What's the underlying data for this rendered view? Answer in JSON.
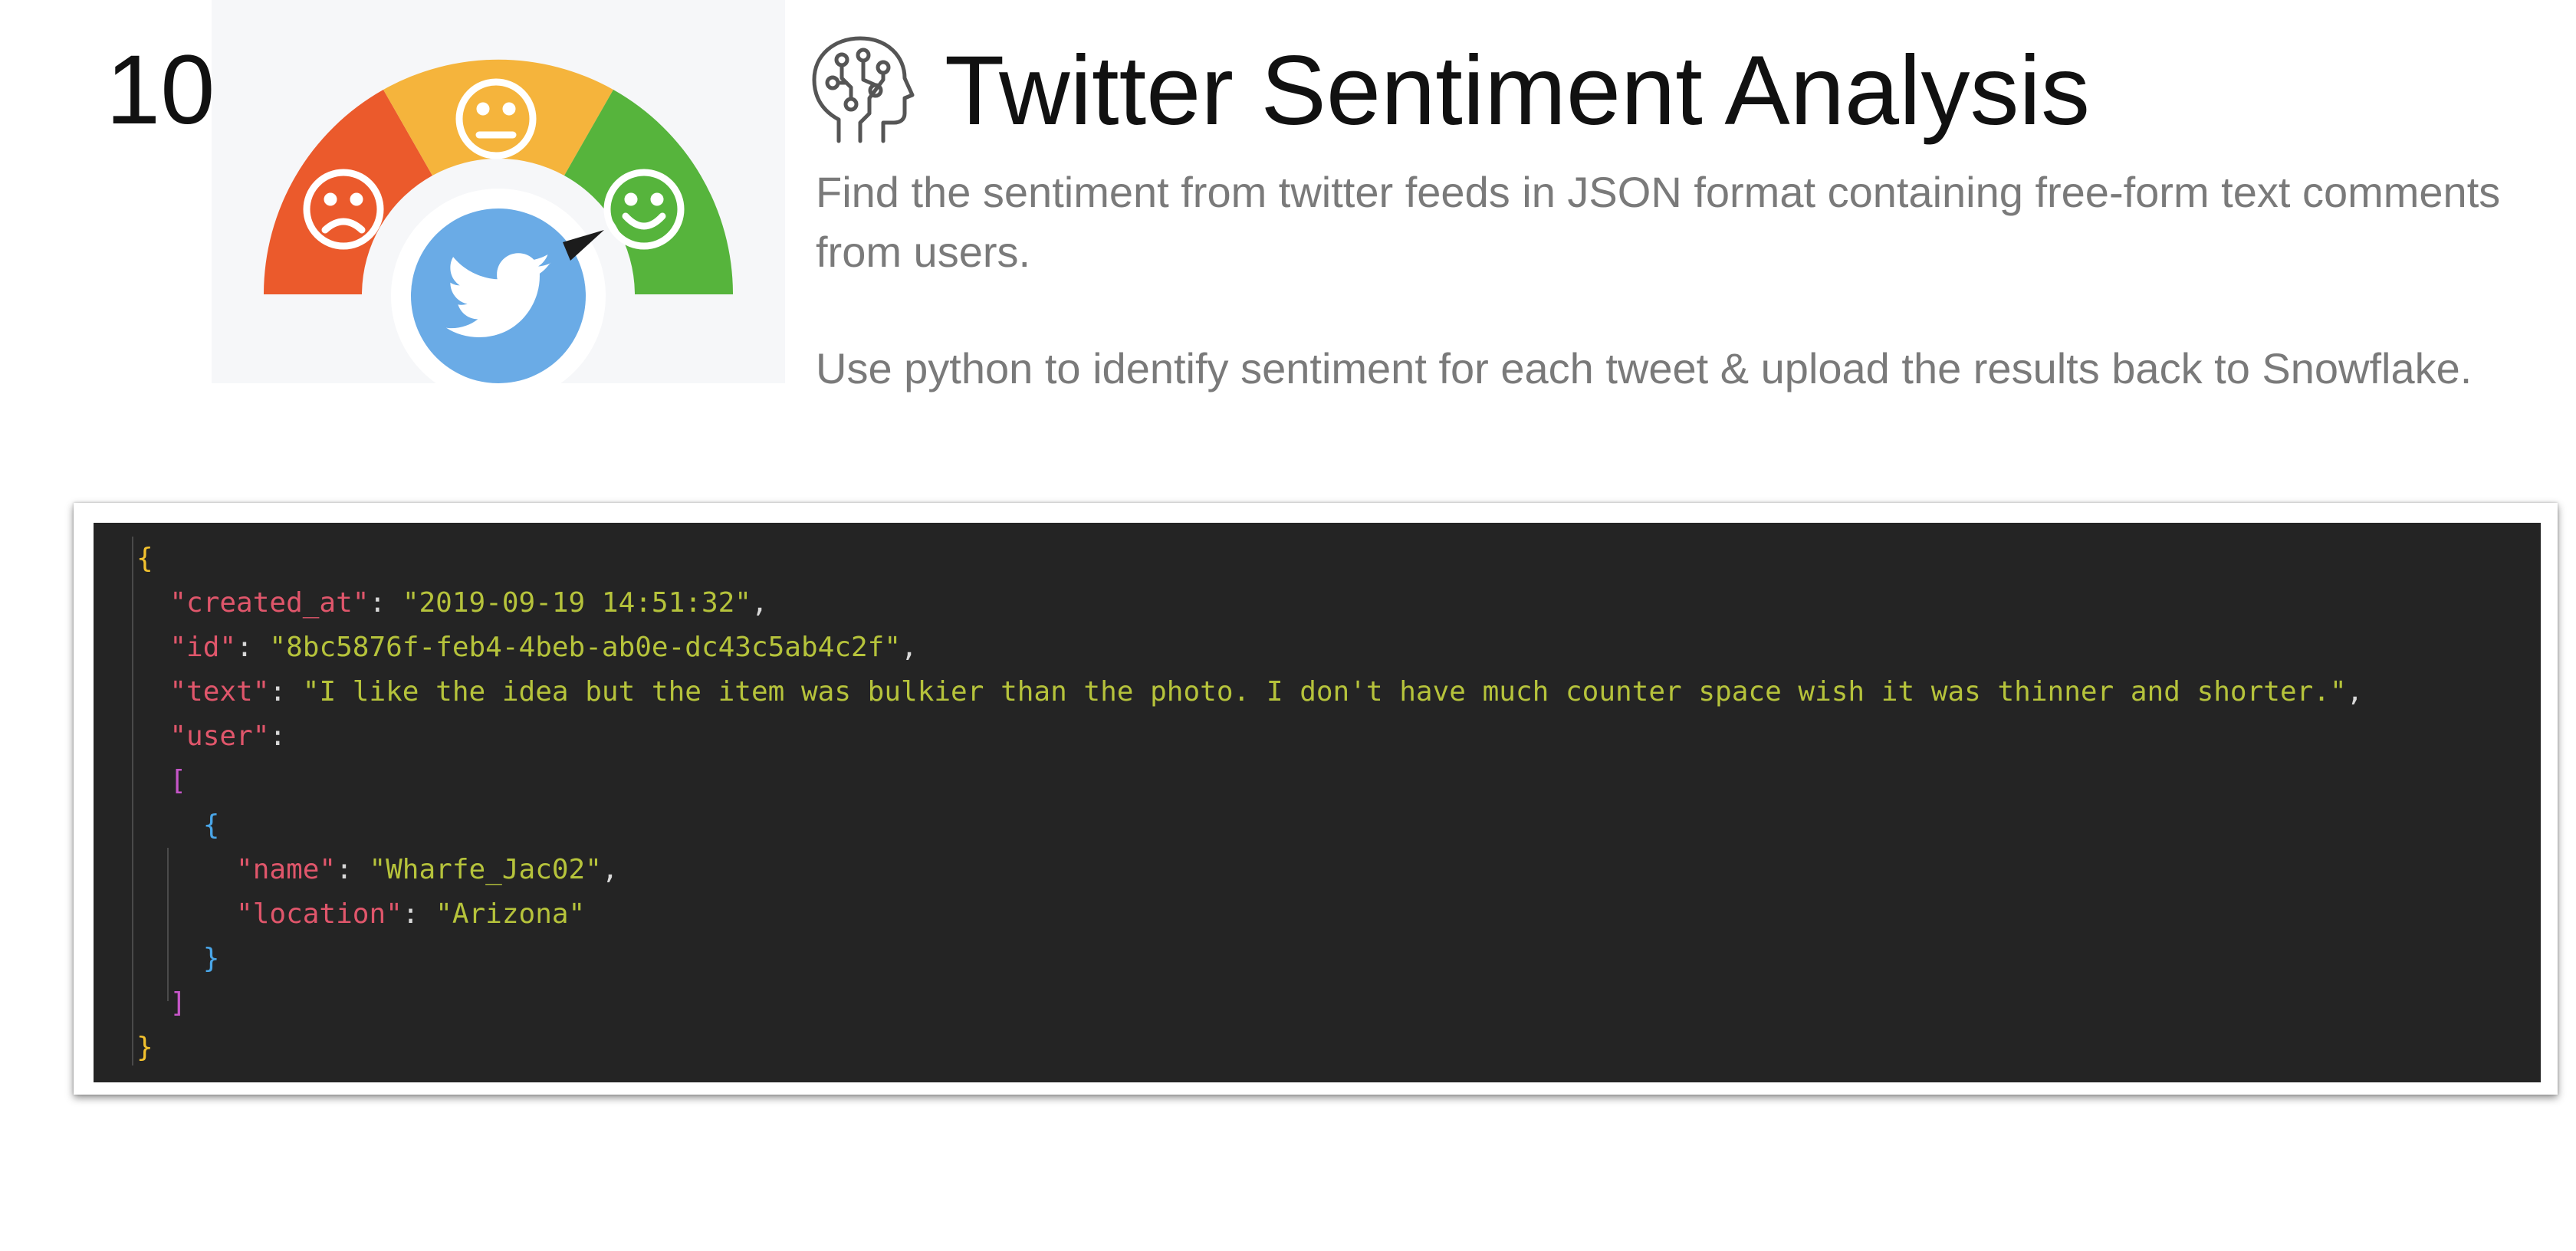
{
  "slide": {
    "number": "10.",
    "title": "Twitter Sentiment Analysis",
    "description_1": "Find the sentiment from twitter feeds in JSON format containing free-form text comments from users.",
    "description_2": "Use python to identify sentiment for each tweet & upload the results back to Snowflake."
  },
  "illustration": {
    "icons": [
      "sad-face-icon",
      "neutral-face-icon",
      "happy-face-icon",
      "twitter-bird-icon",
      "gauge-needle-icon",
      "brain-circuit-icon"
    ],
    "colors": {
      "negative": "#eb5a2c",
      "neutral": "#f5b43c",
      "positive": "#56b43c",
      "twitter": "#6aabe6"
    }
  },
  "code": {
    "open_brace": "{",
    "created_at_key": "\"created_at\"",
    "created_at_value": "\"2019-09-19 14:51:32\"",
    "id_key": "\"id\"",
    "id_value": "\"8bc5876f-feb4-4beb-ab0e-dc43c5ab4c2f\"",
    "text_key": "\"text\"",
    "text_value": "\"I like the idea but the item was bulkier than the photo. I don't have much counter space wish it was thinner and shorter.\"",
    "user_key": "\"user\"",
    "open_bracket": "[",
    "inner_open_brace": "{",
    "name_key": "\"name\"",
    "name_value": "\"Wharfe_Jac02\"",
    "location_key": "\"location\"",
    "location_value": "\"Arizona\"",
    "inner_close_brace": "}",
    "close_bracket": "]",
    "close_brace": "}"
  }
}
